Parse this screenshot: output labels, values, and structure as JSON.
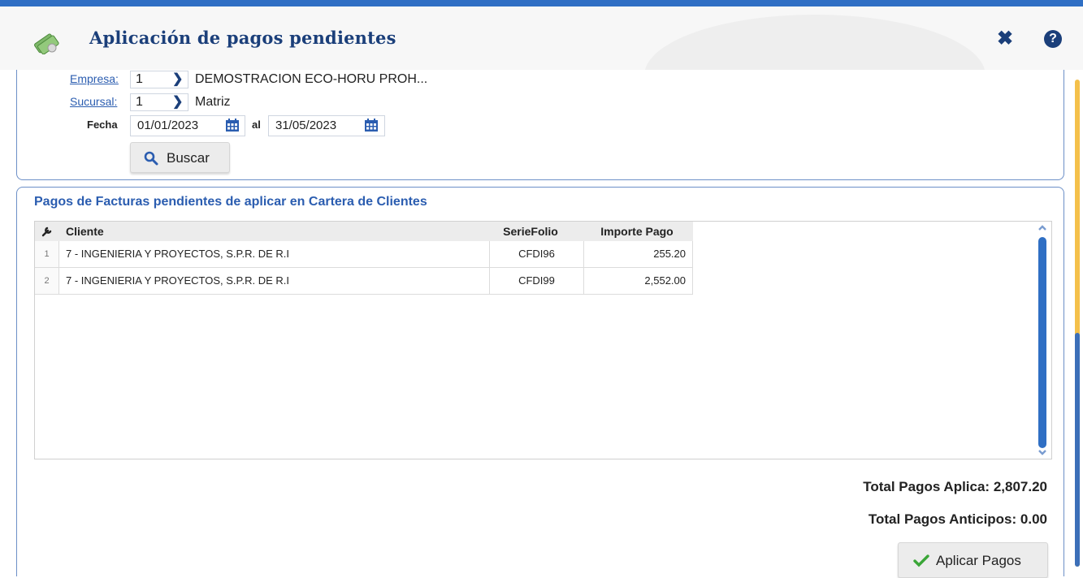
{
  "header": {
    "title": "Aplicación de pagos pendientes",
    "icon": "money-icon",
    "close_icon": "close-icon",
    "help_icon": "help-icon"
  },
  "filters": {
    "empresa_label": "Empresa:",
    "empresa_value": "1",
    "empresa_name": "DEMOSTRACION ECO-HORU PROH...",
    "sucursal_label": "Sucursal:",
    "sucursal_value": "1",
    "sucursal_name": "Matriz",
    "fecha_label": "Fecha",
    "fecha_desde": "01/01/2023",
    "al_label": "al",
    "fecha_hasta": "31/05/2023",
    "buscar_label": "Buscar"
  },
  "results": {
    "section_title": "Pagos de Facturas pendientes de aplicar en Cartera de Clientes",
    "columns": [
      "Cliente",
      "SerieFolio",
      "Importe Pago"
    ],
    "rows": [
      {
        "num": "1",
        "cliente": "7 - INGENIERIA Y PROYECTOS, S.P.R. DE R.I",
        "seriefolio": "CFDI96",
        "importe": "255.20"
      },
      {
        "num": "2",
        "cliente": "7 - INGENIERIA Y PROYECTOS, S.P.R. DE R.I",
        "seriefolio": "CFDI99",
        "importe": "2,552.00"
      }
    ]
  },
  "totals": {
    "aplica": "Total Pagos Aplica: 2,807.20",
    "anticipos": "Total Pagos Anticipos: 0.00",
    "aplicar_label": "Aplicar Pagos"
  },
  "colors": {
    "accent": "#2f6fc4",
    "title": "#1b3f7a",
    "link": "#2b5db0"
  }
}
